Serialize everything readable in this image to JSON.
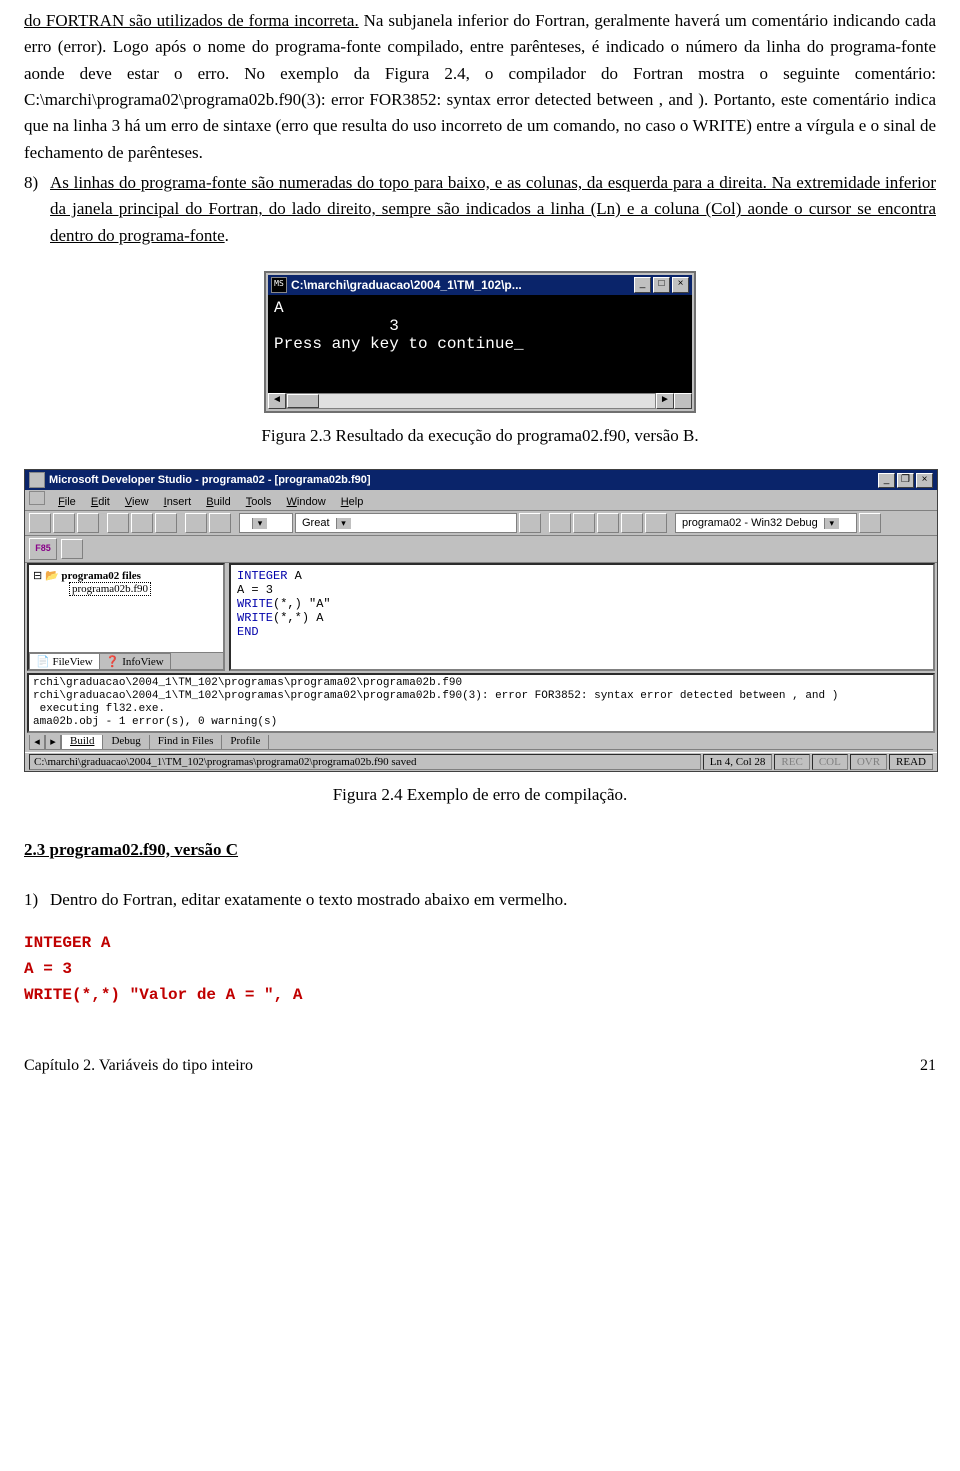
{
  "para1_a": "do FORTRAN são utilizados de forma incorreta.",
  "para1_b": " Na subjanela inferior do Fortran, geralmente haverá um comentário indicando cada erro (error). Logo após o nome do programa-fonte compilado, entre parênteses, é indicado o número da linha do programa-fonte aonde deve estar o erro. No exemplo da ",
  "para1_c": "Figura 2.4, o compilador do Fortran mostra o seguinte comentário:",
  "para1_d": " C:\\marchi\\programa02\\programa02b.f90(3): error FOR3852: syntax error detected between , and ). Portanto, este comentário indica que na linha 3 há um erro de sintaxe (erro que resulta do uso incorreto de um comando, no caso o WRITE) entre a vírgula e o sinal de fechamento de parênteses.",
  "item8_num": "8)",
  "item8_a": "As linhas do programa-fonte são numeradas do topo para baixo, e as colunas, da esquerda para a direita. Na extremidade inferior da janela principal do Fortran, do lado direito, sempre são indicados a linha (Ln) e a coluna (Col) aonde o cursor se encontra dentro do programa-fonte",
  "item8_b": ".",
  "fig23": {
    "title": "C:\\marchi\\graduacao\\2004_1\\TM_102\\p...",
    "body": "A\n            3\nPress any key to continue_"
  },
  "caption23": "Figura 2.3 Resultado da execução do programa02.f90, versão B.",
  "fig24": {
    "title": "Microsoft Developer Studio - programa02 - [programa02b.f90]",
    "menu": [
      "File",
      "Edit",
      "View",
      "Insert",
      "Build",
      "Tools",
      "Window",
      "Help"
    ],
    "combo1": "Great",
    "combo2": "programa02 - Win32 Debug",
    "f85": "F85",
    "tree_root": "programa02 files",
    "tree_file": "programa02b.f90",
    "side_tabs": [
      "FileView",
      "InfoView"
    ],
    "code_lines": [
      {
        "kw": "INTEGER",
        "rest": " A"
      },
      {
        "kw": "",
        "rest": "A = 3"
      },
      {
        "kw": "WRITE",
        "rest": "(*,) \"A\""
      },
      {
        "kw": "WRITE",
        "rest": "(*,*) A"
      },
      {
        "kw": "END",
        "rest": ""
      }
    ],
    "output": "rchi\\graduacao\\2004_1\\TM_102\\programas\\programa02\\programa02b.f90\nrchi\\graduacao\\2004_1\\TM_102\\programas\\programa02\\programa02b.f90(3): error FOR3852: syntax error detected between , and )\n executing fl32.exe.\nama02b.obj - 1 error(s), 0 warning(s)",
    "out_tabs": [
      "Build",
      "Debug",
      "Find in Files",
      "Profile"
    ],
    "status_path": "C:\\marchi\\graduacao\\2004_1\\TM_102\\programas\\programa02\\programa02b.f90 saved",
    "status_ln": "Ln 4, Col 28",
    "status_flags": [
      "REC",
      "COL",
      "OVR",
      "READ"
    ]
  },
  "caption24": "Figura 2.4 Exemplo de erro de compilação.",
  "section_title": "2.3 programa02.f90, versão C",
  "step1_num": "1)",
  "step1_txt": "Dentro do Fortran, editar exatamente o texto mostrado abaixo em vermelho.",
  "code": [
    "INTEGER A",
    "A = 3",
    "WRITE(*,*) \"Valor de A = \", A"
  ],
  "footer_left": "Capítulo 2. Variáveis do tipo inteiro",
  "footer_right": "21"
}
